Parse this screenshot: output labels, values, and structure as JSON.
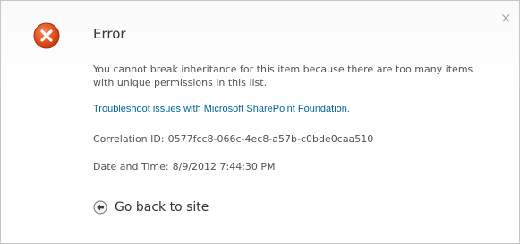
{
  "dialog": {
    "close_glyph": "×",
    "icon": "error-circle-x-icon",
    "title": "Error",
    "message": "You cannot break inheritance for this item because there are too many items with unique permissions in this list.",
    "troubleshoot_link": "Troubleshoot issues with Microsoft SharePoint Foundation.",
    "correlation_label": "Correlation ID:",
    "correlation_id": "0577fcc8-066c-4ec8-a57b-c0bde0caa510",
    "date_label": "Date and Time:",
    "date_value": "8/9/2012 7:44:30 PM",
    "back_label": "Go back to site",
    "back_icon": "back-arrow-circle-icon"
  },
  "colors": {
    "error_red": "#e0501f",
    "link": "#006699",
    "text": "#525252",
    "border": "#c6c6c6"
  }
}
